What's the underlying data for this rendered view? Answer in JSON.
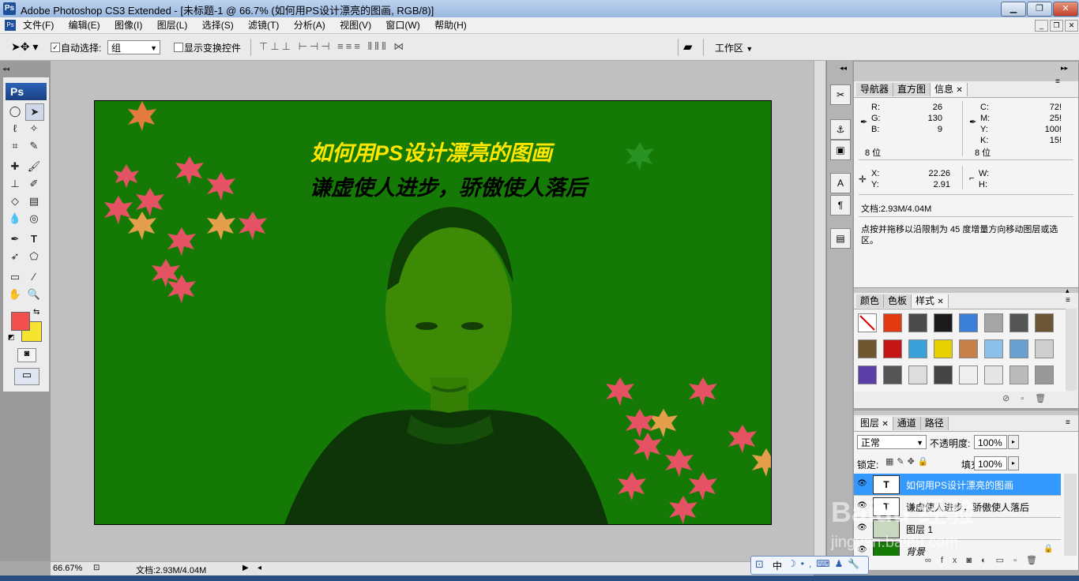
{
  "window": {
    "title": "Adobe Photoshop CS3 Extended - [未标题-1 @ 66.7% (如何用PS设计漂亮的图画, RGB/8)]",
    "app_icon": "Ps"
  },
  "menu": [
    "文件(F)",
    "编辑(E)",
    "图像(I)",
    "图层(L)",
    "选择(S)",
    "滤镜(T)",
    "分析(A)",
    "视图(V)",
    "窗口(W)",
    "帮助(H)"
  ],
  "options": {
    "auto_select_label": "自动选择:",
    "auto_select_value": "组",
    "show_transform_label": "显示变换控件",
    "workspace_label": "工作区"
  },
  "toolbox": {
    "logo": "Ps"
  },
  "canvas": {
    "title": "如何用PS设计漂亮的图画",
    "subtitle": "谦虚使人进步，骄傲使人落后",
    "background": "#157a05",
    "title_color": "#ffe600"
  },
  "info_panel": {
    "tabs": [
      "导航器",
      "直方图",
      "信息"
    ],
    "rgb": [
      {
        "k": "R:",
        "v": "26"
      },
      {
        "k": "G:",
        "v": "130"
      },
      {
        "k": "B:",
        "v": "9"
      }
    ],
    "cmyk": [
      {
        "k": "C:",
        "v": "72!"
      },
      {
        "k": "M:",
        "v": "25!"
      },
      {
        "k": "Y:",
        "v": "100!"
      },
      {
        "k": "K:",
        "v": "15!"
      }
    ],
    "bits_left": "8 位",
    "bits_right": "8 位",
    "x_label": "X:",
    "x_value": "22.26",
    "y_label": "Y:",
    "y_value": "2.91",
    "w_label": "W:",
    "h_label": "H:",
    "doc": "文档:2.93M/4.04M",
    "hint": "点按并拖移以沿限制为 45 度增量方向移动图层或选区。"
  },
  "styles_panel": {
    "tabs": [
      "颜色",
      "色板",
      "样式"
    ],
    "swatches": [
      "#ffffff",
      "#e23a10",
      "#4a4a4a",
      "#1a1a1a",
      "#3b7ed6",
      "#a5a5a5",
      "#555555",
      "#6b5535",
      "#6d5630",
      "#c41414",
      "#3aa0d8",
      "#e8d100",
      "#c8804a",
      "#8cc0e8",
      "#6aa0d0",
      "#cfcfcf",
      "#5a3fa8",
      "#555555",
      "#dddddd",
      "#444444",
      "#eeeeee",
      "#e6e6e6",
      "#bbbbbb",
      "#999999"
    ]
  },
  "layers_panel": {
    "tabs": [
      "图层",
      "通道",
      "路径"
    ],
    "blend": "正常",
    "opacity_label": "不透明度:",
    "opacity": "100%",
    "lock_label": "锁定:",
    "fill_label": "填充:",
    "fill": "100%",
    "layers": [
      {
        "name": "如何用PS设计漂亮的图画",
        "thumb": "T",
        "selected": true
      },
      {
        "name": "谦虚使人进步，骄傲使人落后",
        "thumb": "T",
        "selected": false
      },
      {
        "name": "图层 1",
        "thumb": "img",
        "selected": false
      },
      {
        "name": "背景",
        "thumb": "bg",
        "selected": false
      }
    ]
  },
  "status": {
    "zoom": "66.67%",
    "doc": "文档:2.93M/4.04M"
  },
  "ime": {
    "mode": "中"
  },
  "watermark": {
    "text": "Baidu 经验",
    "url": "jingyan.baidu.com"
  }
}
